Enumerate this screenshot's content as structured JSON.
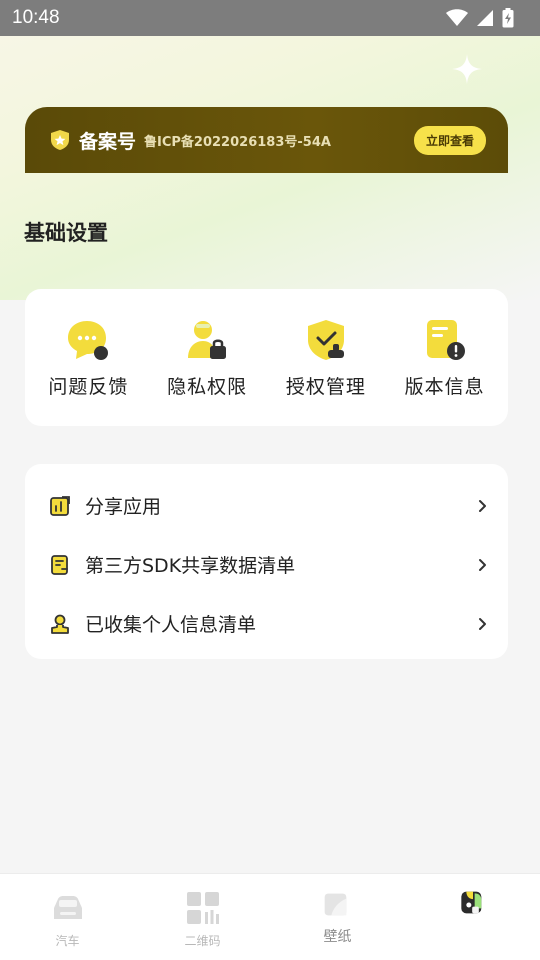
{
  "status_bar": {
    "time": "10:48",
    "icons": [
      "wifi-icon",
      "signal-icon",
      "battery-icon"
    ]
  },
  "icp_banner": {
    "title": "备案号",
    "number": "鲁ICP备2022026183号-54A",
    "button": "立即查看"
  },
  "section": {
    "title": "基础设置"
  },
  "grid": {
    "items": [
      {
        "label": "问题反馈",
        "icon": "feedback-icon"
      },
      {
        "label": "隐私权限",
        "icon": "privacy-icon"
      },
      {
        "label": "授权管理",
        "icon": "authorization-icon"
      },
      {
        "label": "版本信息",
        "icon": "version-info-icon"
      }
    ]
  },
  "list": {
    "items": [
      {
        "label": "分享应用",
        "icon": "share-icon"
      },
      {
        "label": "第三方SDK共享数据清单",
        "icon": "sdk-list-icon"
      },
      {
        "label": "已收集个人信息清单",
        "icon": "personal-info-icon"
      }
    ]
  },
  "nav": {
    "items": [
      {
        "label": "汽车",
        "icon": "car-icon"
      },
      {
        "label": "二维码",
        "icon": "qrcode-icon"
      },
      {
        "label": "壁纸",
        "icon": "wallpaper-icon"
      },
      {
        "label": "",
        "icon": "profile-icon"
      }
    ]
  },
  "colors": {
    "accent_yellow": "#f7e14a",
    "banner_brown": "#5a4a08",
    "background": "#f5f5f5"
  }
}
